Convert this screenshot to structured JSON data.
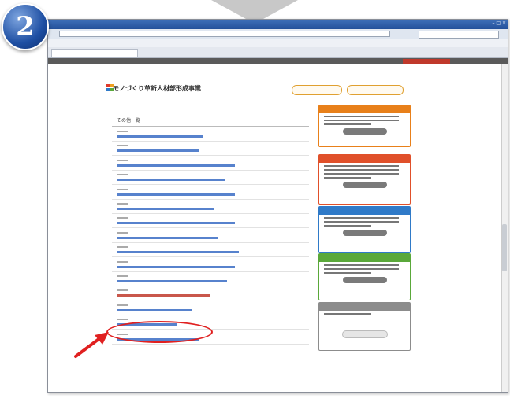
{
  "step_number": "2",
  "browser": {
    "title": "",
    "tab_label": "",
    "window_buttons": "– □ ×"
  },
  "site": {
    "title": "モノづくり革新人材部形成事業",
    "header_buttons": [
      "",
      ""
    ]
  },
  "main": {
    "list_heading": "その他一覧",
    "items": [
      {
        "date_width": 14,
        "link_width": 110
      },
      {
        "date_width": 14,
        "link_width": 104
      },
      {
        "date_width": 14,
        "link_width": 150
      },
      {
        "date_width": 14,
        "link_width": 138
      },
      {
        "date_width": 14,
        "link_width": 150
      },
      {
        "date_width": 14,
        "link_width": 124
      },
      {
        "date_width": 14,
        "link_width": 150
      },
      {
        "date_width": 14,
        "link_width": 128
      },
      {
        "date_width": 14,
        "link_width": 155
      },
      {
        "date_width": 14,
        "link_width": 150
      },
      {
        "date_width": 14,
        "link_width": 140
      },
      {
        "date_width": 14,
        "link_width": 118,
        "highlighted": true
      },
      {
        "date_width": 14,
        "link_width": 95
      },
      {
        "date_width": 14,
        "link_width": 76
      },
      {
        "date_width": 14,
        "link_width": 104
      }
    ]
  },
  "sidebar": {
    "boxes": [
      {
        "color": "#e8801a"
      },
      {
        "color": "#e0502a"
      },
      {
        "color": "#2f7ac8"
      },
      {
        "color": "#5aa83a"
      },
      {
        "color": "#8c8c8c"
      }
    ]
  },
  "colors": {
    "badge": "#1e4fa3",
    "highlight": "#e02020",
    "link": "#3a6cc4"
  },
  "icons": [
    "step-badge-icon",
    "funnel-arrow-icon",
    "red-pointer-arrow-icon"
  ]
}
